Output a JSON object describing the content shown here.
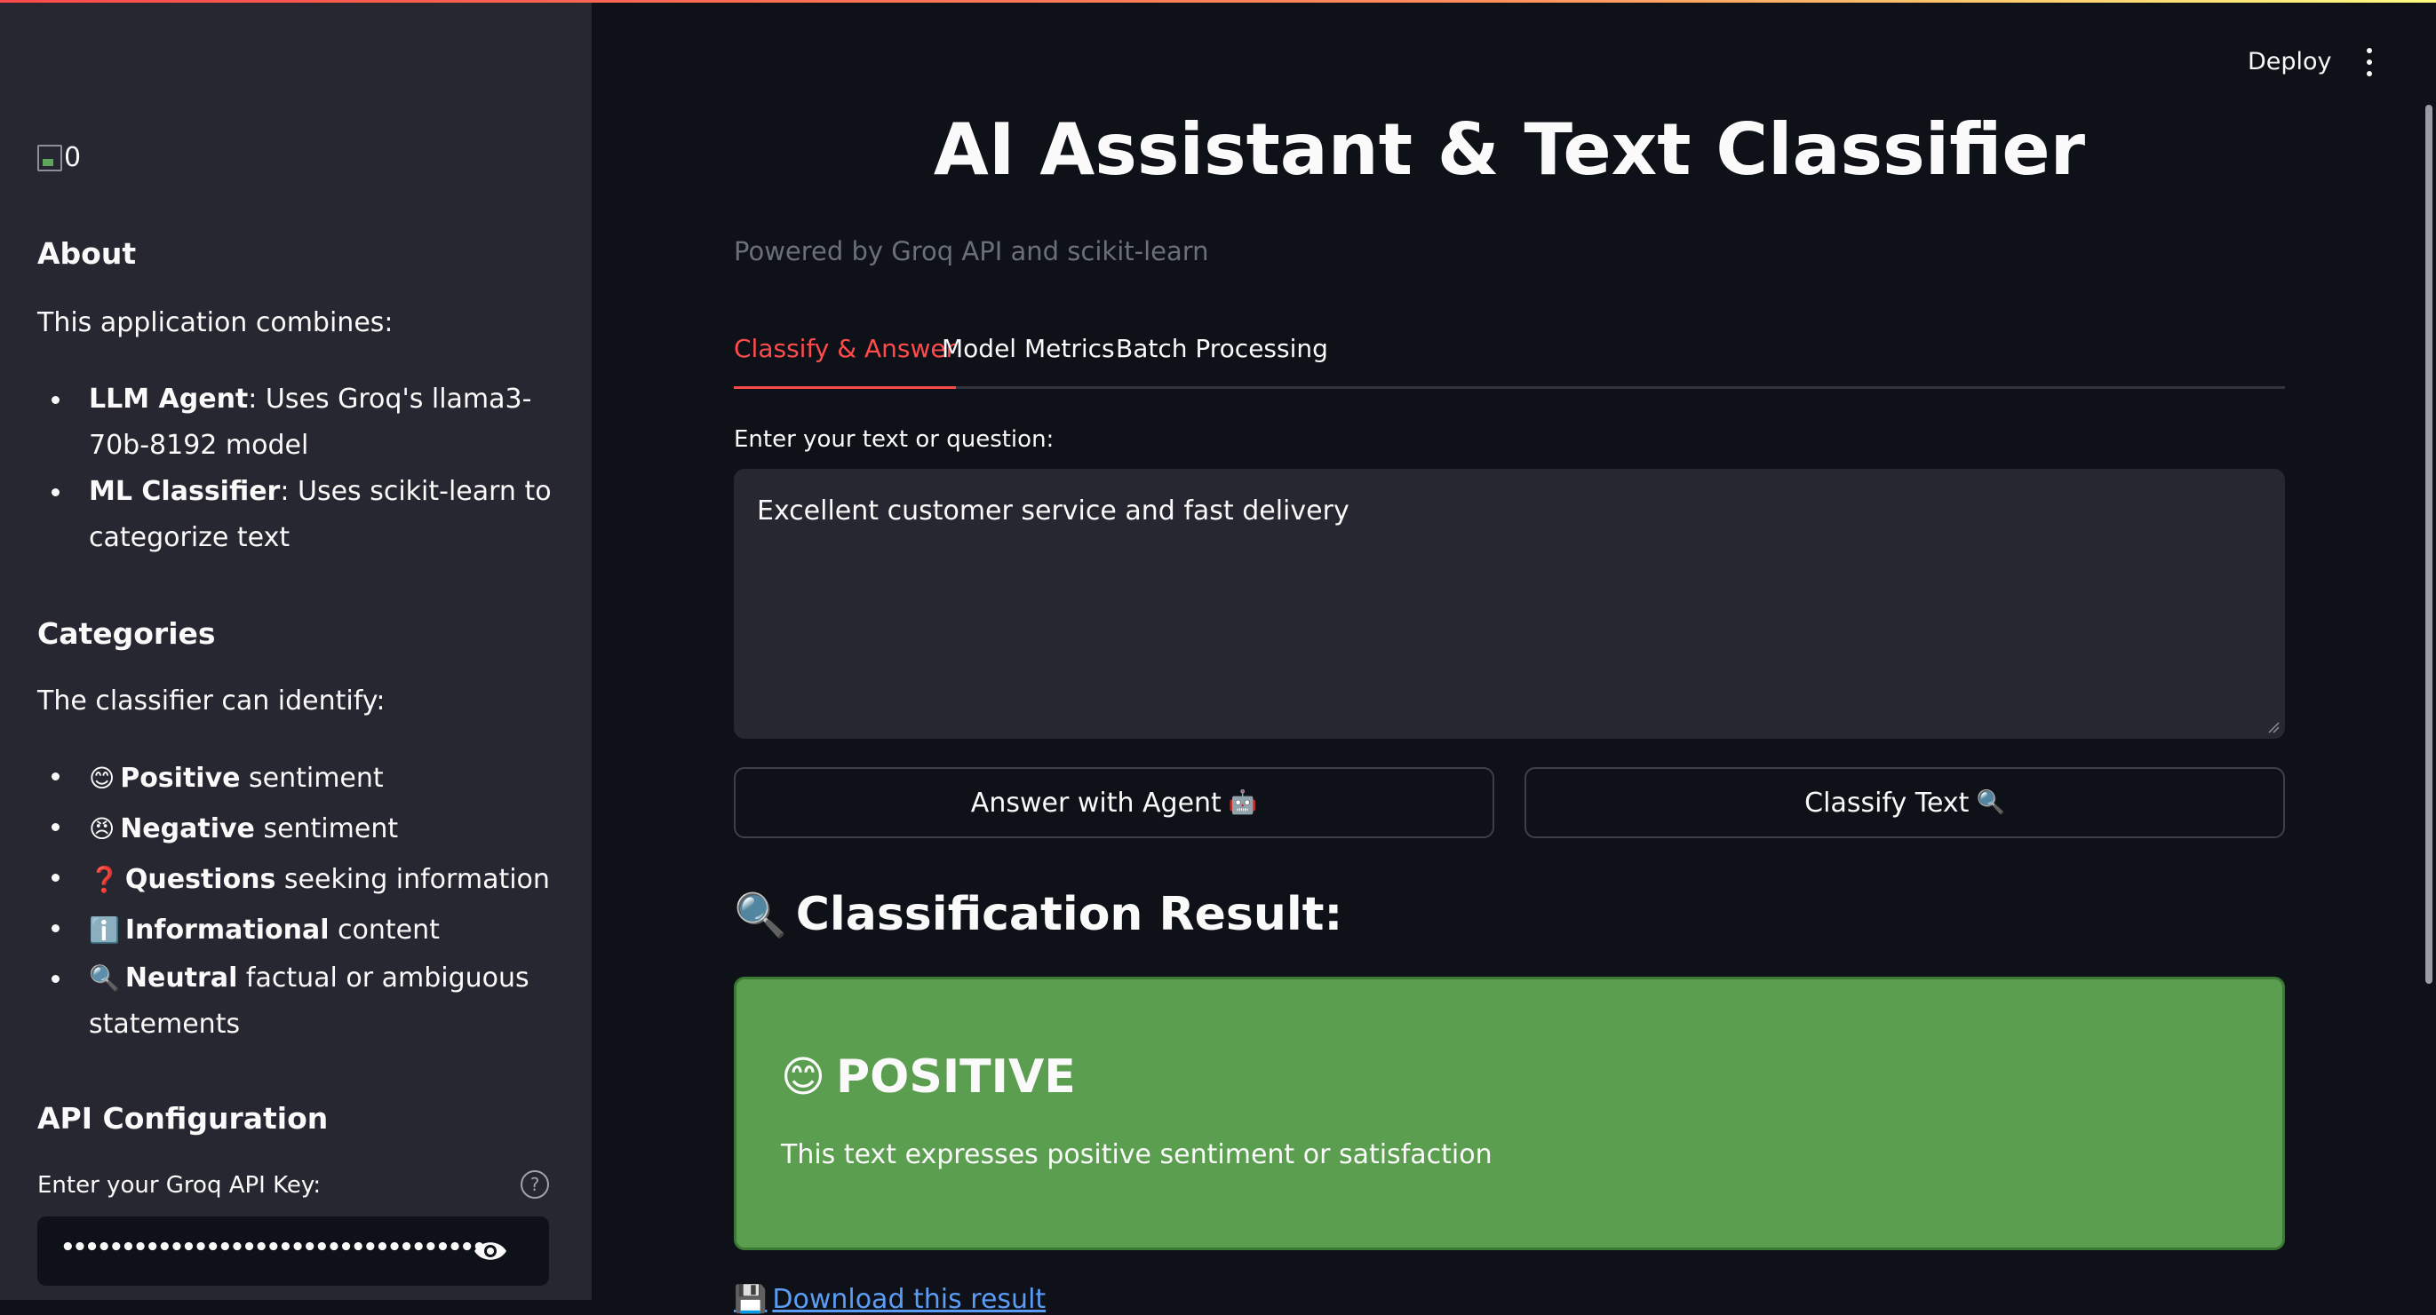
{
  "header": {
    "deploy_label": "Deploy",
    "menu_icon": "kebab-menu-icon"
  },
  "sidebar": {
    "logo_alt": "0",
    "about": {
      "heading": "About",
      "intro": "This application combines:",
      "items": [
        {
          "bold": "LLM Agent",
          "text": ": Uses Groq's llama3-70b-8192 model"
        },
        {
          "bold": "ML Classifier",
          "text": ": Uses scikit-learn to categorize text"
        }
      ]
    },
    "categories": {
      "heading": "Categories",
      "intro": "The classifier can identify:",
      "items": [
        {
          "emoji": "😊",
          "bold": "Positive",
          "text": " sentiment"
        },
        {
          "emoji": "😠",
          "bold": "Negative",
          "text": " sentiment"
        },
        {
          "emoji": "❓",
          "bold": "Questions",
          "text": " seeking information"
        },
        {
          "emoji": "ℹ️",
          "bold": "Informational",
          "text": " content"
        },
        {
          "emoji": "🔍",
          "bold": "Neutral",
          "text": " factual or ambiguous statements"
        }
      ]
    },
    "api": {
      "heading": "API Configuration",
      "label": "Enter your Groq API Key:",
      "value_masked": "••••••••••••••••••••••••••••••••••••••••••••••••••••••••"
    }
  },
  "main": {
    "title": "AI Assistant & Text Classifier",
    "subtitle": "Powered by Groq API and scikit-learn",
    "tabs": [
      {
        "label": "Classify & Answer",
        "active": true
      },
      {
        "label": "Model Metrics",
        "active": false
      },
      {
        "label": "Batch Processing",
        "active": false
      }
    ],
    "input_label": "Enter your text or question:",
    "input_value": "Excellent customer service and fast delivery",
    "buttons": {
      "answer": {
        "label": "Answer with Agent",
        "emoji": "🤖"
      },
      "classify": {
        "label": "Classify Text",
        "emoji": "🔍"
      }
    },
    "result": {
      "heading_emoji": "🔍",
      "heading": "Classification Result:",
      "emoji": "😊",
      "label": "POSITIVE",
      "description": "This text expresses positive sentiment or satisfaction",
      "color": "#5c9e4f"
    },
    "download": {
      "emoji": "💾",
      "label": "Download this result"
    }
  },
  "colors": {
    "background": "#0e1117",
    "sidebar": "#262730",
    "accent": "#ff4b4b",
    "link": "#5b9cf5"
  }
}
